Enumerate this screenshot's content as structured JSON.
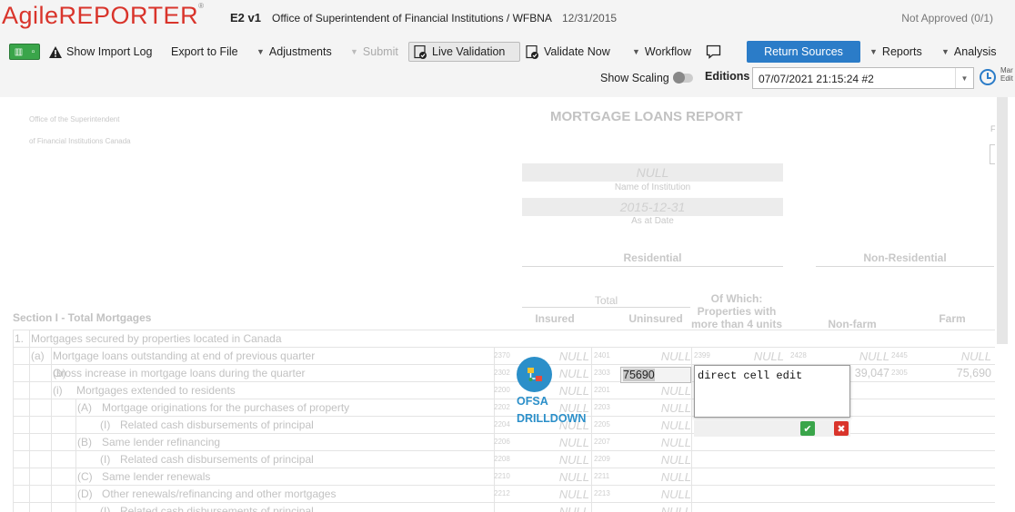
{
  "app": {
    "logo_text": "AgileREPORTER",
    "return_id": "E2 v1",
    "institution": "Office of Superintendent of Financial Institutions / WFBNA",
    "period_end": "12/31/2015",
    "approval_status": "Not Approved (0/1)"
  },
  "toolbar": {
    "show_import_log": "Show Import Log",
    "export_to_file": "Export to File",
    "adjustments": "Adjustments",
    "submit": "Submit",
    "live_validation": "Live Validation",
    "validate_now": "Validate Now",
    "workflow": "Workflow",
    "return_sources": "Return Sources",
    "reports": "Reports",
    "analysis": "Analysis",
    "show_scaling": "Show Scaling",
    "editions_label": "Editions",
    "editions_value": "07/07/2021 21:15:24 #2",
    "clock_label": "Mar Edit"
  },
  "form": {
    "header_line1": "Office of the Superintendent",
    "header_line2": "of Financial Institutions Canada",
    "title": "MORTGAGE LOANS REPORT",
    "name_value": "NULL",
    "name_caption": "Name of Institution",
    "date_value": "2015-12-31",
    "date_caption": "As at Date",
    "residential": "Residential",
    "non_residential": "Non-Residential",
    "total": "Total",
    "of_which": "Of Which: Properties with more than 4 units",
    "insured": "Insured",
    "uninsured": "Uninsured",
    "non_farm": "Non-farm",
    "farm": "Farm",
    "section_title": "Section I - Total Mortgages",
    "side_fragment": "F"
  },
  "rows": [
    {
      "num": "1.",
      "label": "Mortgages secured by properties located in Canada"
    },
    {
      "num": "(a)",
      "label": "Mortgage loans outstanding at end of previous quarter",
      "c1": "2370",
      "v1": "NULL",
      "c2": "2401",
      "v2": "NULL",
      "c3": "2399",
      "v3": "NULL",
      "c4": "2428",
      "v4": "NULL",
      "c5": "2445",
      "v5": "NULL"
    },
    {
      "num": "(b)",
      "label": "Gross increase in mortgage loans during the quarter",
      "c1": "2302",
      "v1": "NULL",
      "c2": "2303",
      "c3": "2304",
      "v4": "39,047",
      "c5": "2305",
      "v5": "75,690"
    },
    {
      "num": "(i)",
      "label": "Mortgages extended to residents",
      "c1": "2200",
      "v1": "NULL",
      "c2": "2201",
      "v2": "NULL"
    },
    {
      "num": "(A)",
      "label": "Mortgage originations for the purchases of property",
      "c1": "2202",
      "v1": "NULL",
      "c2": "2203",
      "v2": "NULL"
    },
    {
      "num": "(I)",
      "label": "Related cash disbursements of principal",
      "c1": "2204",
      "v1": "NULL",
      "c2": "2205",
      "v2": "NULL"
    },
    {
      "num": "(B)",
      "label": "Same lender refinancing",
      "c1": "2206",
      "v1": "NULL",
      "c2": "2207",
      "v2": "NULL"
    },
    {
      "num": "(I)",
      "label": "Related cash disbursements of principal",
      "c1": "2208",
      "v1": "NULL",
      "c2": "2209",
      "v2": "NULL"
    },
    {
      "num": "(C)",
      "label": "Same lender renewals",
      "c1": "2210",
      "v1": "NULL",
      "c2": "2211",
      "v2": "NULL"
    },
    {
      "num": "(D)",
      "label": "Other renewals/refinancing and other mortgages",
      "c1": "2212",
      "v1": "NULL",
      "c2": "2213",
      "v2": "NULL"
    },
    {
      "num": "(I)",
      "label": "Related cash disbursements of principal",
      "v1": "NULL",
      "v2": "NULL"
    }
  ],
  "editing": {
    "cell_value": "75690",
    "comment_text": "direct cell edit",
    "confirm_icon": "check-icon",
    "cancel_icon": "x-icon"
  },
  "drilldown": {
    "label": "OFSA DRILLDOWN"
  },
  "colors": {
    "logo_red": "#d9342b",
    "primary_blue": "#2b7cc8",
    "drilldown_blue": "#2b8fc9",
    "ok_green": "#3aa54a"
  }
}
